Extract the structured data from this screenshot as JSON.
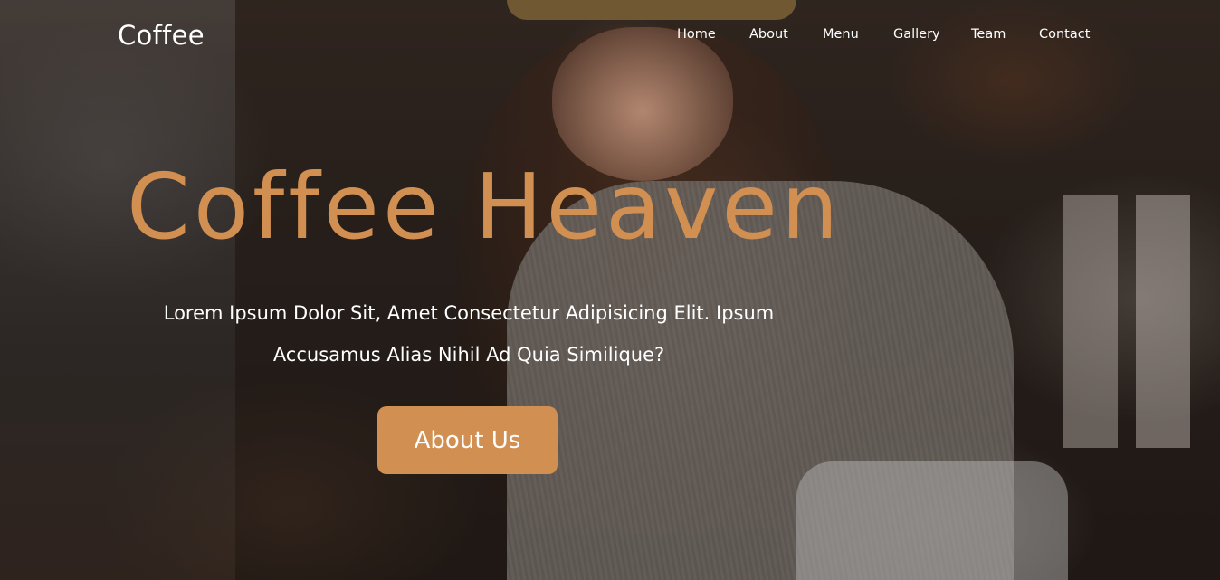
{
  "nav": {
    "brand": "Coffee",
    "links": [
      {
        "label": "Home"
      },
      {
        "label": "About"
      },
      {
        "label": "Menu"
      },
      {
        "label": "Gallery"
      },
      {
        "label": "Team"
      },
      {
        "label": "Contact"
      }
    ]
  },
  "hero": {
    "title": "Coffee Heaven",
    "subtitle": "Lorem Ipsum Dolor Sit, Amet Consectetur Adipisicing Elit. Ipsum Accusamus Alias Nihil Ad Quia Similique?",
    "button_label": "About Us"
  },
  "colors": {
    "accent": "#d18f52",
    "text": "#ffffff"
  }
}
